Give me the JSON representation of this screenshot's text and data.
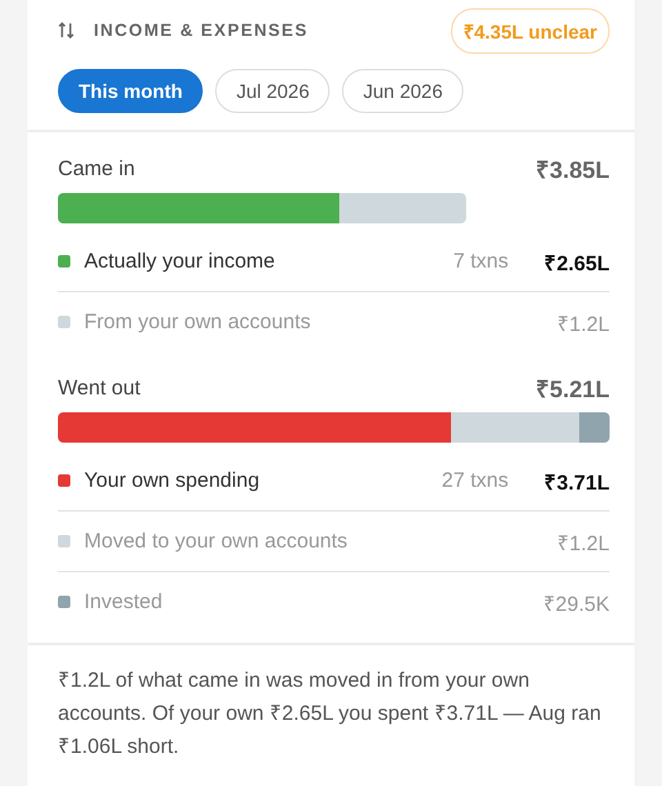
{
  "header": {
    "title": "INCOME & EXPENSES",
    "badge": "₹4.35L unclear"
  },
  "periods": [
    {
      "label": "This month",
      "selected": true
    },
    {
      "label": "Jul 2026",
      "selected": false
    },
    {
      "label": "Jun 2026",
      "selected": false
    }
  ],
  "sections": [
    {
      "title": "Came in",
      "total": "₹3.85L",
      "level": 0.74,
      "items": [
        {
          "label": "Actually your income",
          "kind": "primary",
          "count": "7 txns",
          "amount": "₹2.65L",
          "color": "#4caf50",
          "level": 0.69
        },
        {
          "label": "From your own accounts",
          "kind": "secondary",
          "amount": "₹1.2L",
          "color": "#cfd8dc"
        }
      ]
    },
    {
      "title": "Went out",
      "total": "₹5.21L",
      "level": 1,
      "items": [
        {
          "label": "Your own spending",
          "kind": "primary",
          "count": "27 txns",
          "amount": "₹3.71L",
          "color": "#e53935",
          "level": 0.712
        },
        {
          "label": "Moved to your own accounts",
          "kind": "secondary",
          "amount": "₹1.2L",
          "color": "#cfd8dc"
        },
        {
          "label": "Invested",
          "kind": "secondary",
          "amount": "₹29.5K",
          "color": "#90a4ae",
          "level": 0.056
        }
      ]
    }
  ],
  "summary": "₹1.2L of what came in was moved in from your own accounts. Of your own ₹2.65L you spent ₹3.71L — Aug ran ₹1.06L short."
}
